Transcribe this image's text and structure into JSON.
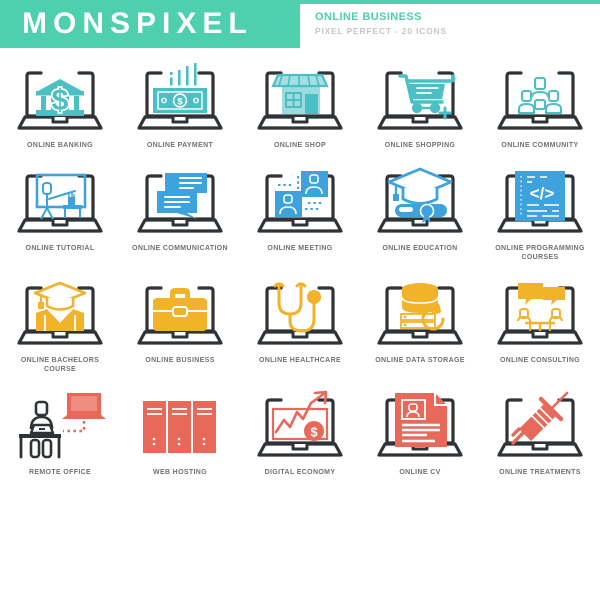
{
  "header": {
    "brand": "MONSPIXEL",
    "title": "ONLINE BUSINESS",
    "subtitle": "PIXEL PERFECT - 20 ICONS",
    "brand_bg": "#4ecfae",
    "title_color": "#4ecfae",
    "subtitle_color": "#c3c7c9"
  },
  "palette": {
    "teal": "#4bbfc3",
    "blue": "#3ea3dc",
    "amber": "#f2b229",
    "coral": "#e8685a",
    "outline": "#2f3336",
    "label": "#6d7275"
  },
  "rows": [
    {
      "accent": "#4bbfc3",
      "icons": [
        {
          "id": "online-banking",
          "label": "ONLINE BANKING",
          "glyph": "bank-column"
        },
        {
          "id": "online-payment",
          "label": "ONLINE PAYMENT",
          "glyph": "banknote-chart"
        },
        {
          "id": "online-shop",
          "label": "ONLINE SHOP",
          "glyph": "storefront"
        },
        {
          "id": "online-shopping",
          "label": "ONLINE SHOPPING",
          "glyph": "shopping-cart-plus"
        },
        {
          "id": "online-community",
          "label": "ONLINE COMMUNITY",
          "glyph": "people-network"
        }
      ]
    },
    {
      "accent": "#3ea3dc",
      "icons": [
        {
          "id": "online-tutorial",
          "label": "ONLINE TUTORIAL",
          "glyph": "teacher-whiteboard"
        },
        {
          "id": "online-communication",
          "label": "ONLINE COMMUNICATION",
          "glyph": "chat-bubbles"
        },
        {
          "id": "online-meeting",
          "label": "ONLINE MEETING",
          "glyph": "video-call-windows"
        },
        {
          "id": "online-education",
          "label": "ONLINE EDUCATION",
          "glyph": "graduation-cap-diploma"
        },
        {
          "id": "online-programming",
          "label": "ONLINE PROGRAMMING COURSES",
          "glyph": "code-document"
        }
      ]
    },
    {
      "accent": "#f2b229",
      "icons": [
        {
          "id": "online-bachelors",
          "label": "ONLINE BACHELORS COURSE",
          "glyph": "graduate-person"
        },
        {
          "id": "online-business",
          "label": "ONLINE BUSINESS",
          "glyph": "briefcase"
        },
        {
          "id": "online-healthcare",
          "label": "ONLINE HEALTHCARE",
          "glyph": "stethoscope"
        },
        {
          "id": "online-data",
          "label": "ONLINE DATA STORAGE",
          "glyph": "database-sync"
        },
        {
          "id": "online-consulting",
          "label": "ONLINE CONSULTING",
          "glyph": "two-people-table-chat"
        }
      ]
    },
    {
      "accent": "#e8685a",
      "icons": [
        {
          "id": "remote-office",
          "label": "REMOTE OFFICE",
          "glyph": "desk-person-laptop-link"
        },
        {
          "id": "web-hosting",
          "label": "WEB HOSTING",
          "glyph": "server-racks"
        },
        {
          "id": "digital-economy",
          "label": "DIGITAL ECONOMY",
          "glyph": "growth-chart-dollar"
        },
        {
          "id": "online-cv",
          "label": "ONLINE CV",
          "glyph": "resume-document"
        },
        {
          "id": "online-treatments",
          "label": "ONLINE TREATMENTS",
          "glyph": "syringe"
        }
      ]
    }
  ]
}
